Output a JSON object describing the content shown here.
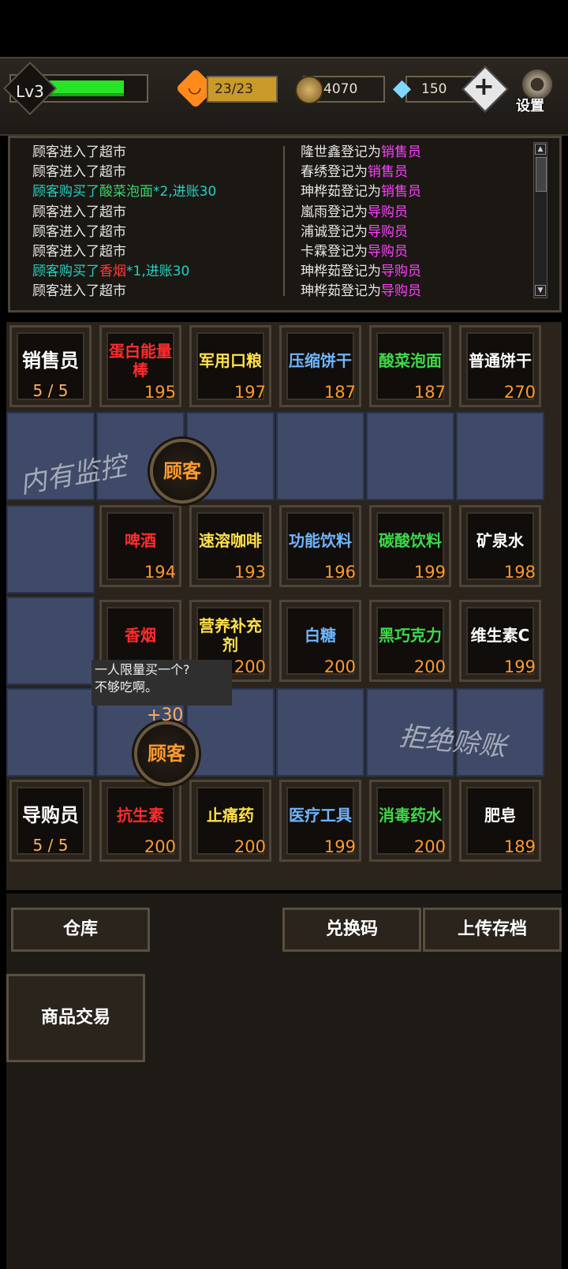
{
  "hud": {
    "level": "Lv3",
    "hp_fill": 0.86,
    "mood": "23/23",
    "coins": "4070",
    "diamonds": "150",
    "settings_label": "设置"
  },
  "log_left": [
    {
      "text": "顾客进入了超市",
      "parts": []
    },
    {
      "text": "顾客进入了超市",
      "parts": []
    },
    {
      "text": "顾客购买了",
      "item": "酸菜泡面",
      "tail": "*2,进账30",
      "color": "#22d1c2",
      "itemColor": "#3cd46a"
    },
    {
      "text": "顾客进入了超市",
      "parts": []
    },
    {
      "text": "顾客进入了超市",
      "parts": []
    },
    {
      "text": "顾客进入了超市",
      "parts": []
    },
    {
      "text": "顾客购买了",
      "item": "香烟",
      "tail": "*1,进账30",
      "color": "#22d1c2",
      "itemColor": "#ff3b3b"
    },
    {
      "text": "顾客进入了超市",
      "parts": []
    }
  ],
  "log_right": [
    {
      "name": "隆世鑫登记为",
      "role": "销售员"
    },
    {
      "name": "春绣登记为",
      "role": "销售员"
    },
    {
      "name": "珅桦茹登记为",
      "role": "销售员"
    },
    {
      "name": "嵐雨登记为",
      "role": "导购员"
    },
    {
      "name": "浦诚登记为",
      "role": "导购员"
    },
    {
      "name": "卡霖登记为",
      "role": "导购员"
    },
    {
      "name": "珅桦茹登记为",
      "role": "导购员"
    },
    {
      "name": "珅桦茹登记为",
      "role": "导购员"
    }
  ],
  "roles": {
    "seller": {
      "label": "销售员",
      "count": "5 / 5"
    },
    "guide": {
      "label": "导购员",
      "count": "5 / 5"
    }
  },
  "shelf_row1": [
    {
      "name": "蛋白能量棒",
      "price": "195",
      "color": "#ff2d2d"
    },
    {
      "name": "军用口粮",
      "price": "197",
      "color": "#ffe14a"
    },
    {
      "name": "压缩饼干",
      "price": "187",
      "color": "#6fb6ff"
    },
    {
      "name": "酸菜泡面",
      "price": "187",
      "color": "#3ed94a"
    },
    {
      "name": "普通饼干",
      "price": "270",
      "color": "#ffffff"
    }
  ],
  "shelf_row2": [
    {
      "name": "啤酒",
      "price": "194",
      "color": "#ff2d2d"
    },
    {
      "name": "速溶咖啡",
      "price": "193",
      "color": "#ffe14a"
    },
    {
      "name": "功能饮料",
      "price": "196",
      "color": "#6fb6ff"
    },
    {
      "name": "碳酸饮料",
      "price": "199",
      "color": "#3ed94a"
    },
    {
      "name": "矿泉水",
      "price": "198",
      "color": "#ffffff"
    }
  ],
  "shelf_row3": [
    {
      "name": "香烟",
      "price": "",
      "color": "#ff2d2d"
    },
    {
      "name": "营养补充剂",
      "price": "200",
      "color": "#ffe14a"
    },
    {
      "name": "白糖",
      "price": "200",
      "color": "#6fb6ff"
    },
    {
      "name": "黑巧克力",
      "price": "200",
      "color": "#3ed94a"
    },
    {
      "name": "维生素C",
      "price": "199",
      "color": "#ffffff"
    }
  ],
  "shelf_row4": [
    {
      "name": "抗生素",
      "price": "200",
      "color": "#ff2d2d"
    },
    {
      "name": "止痛药",
      "price": "200",
      "color": "#ffe14a"
    },
    {
      "name": "医疗工具",
      "price": "199",
      "color": "#6fb6ff"
    },
    {
      "name": "消毒药水",
      "price": "200",
      "color": "#3ed94a"
    },
    {
      "name": "肥皂",
      "price": "189",
      "color": "#ffffff"
    }
  ],
  "floor": {
    "watermark1": "内有监控",
    "watermark2": "拒绝赊账",
    "customer_label": "顾客",
    "income_popup": "+30",
    "tooltip": [
      "一人限量买一个?",
      "不够吃啊。"
    ]
  },
  "buttons": {
    "warehouse": "仓库",
    "redeem": "兑换码",
    "upload": "上传存档",
    "trade": "商品交易"
  },
  "colors": {
    "seller_role": "#ff40ff",
    "guide_role": "#ff40ff",
    "price": "#ff9a2e"
  }
}
